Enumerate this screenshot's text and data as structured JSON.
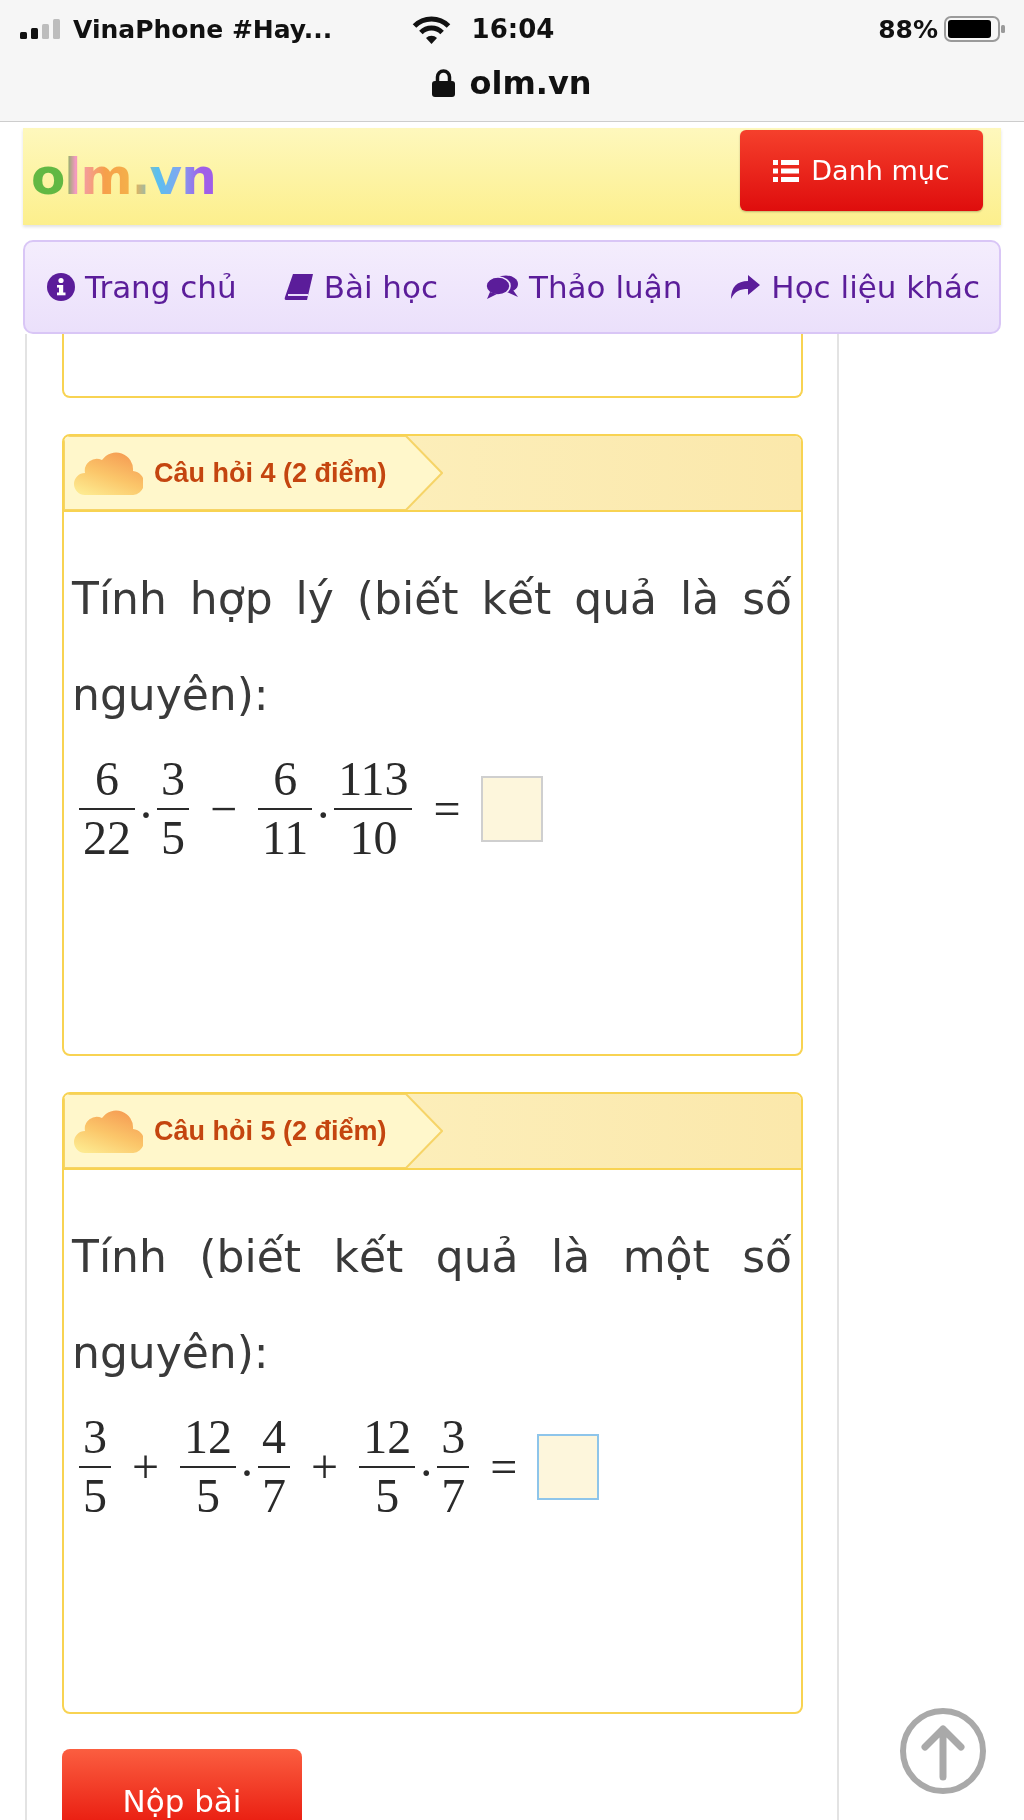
{
  "status_bar": {
    "carrier": "VinaPhone #Hay...",
    "time": "16:04",
    "battery": "88%",
    "url": "olm.vn"
  },
  "header": {
    "logo": "olm.vn",
    "menu_button": "Danh mục"
  },
  "nav": {
    "items": [
      {
        "kind": "info",
        "label": "Trang chủ"
      },
      {
        "kind": "book",
        "label": "Bài học"
      },
      {
        "kind": "comments",
        "label": "Thảo luận"
      },
      {
        "kind": "share",
        "label": "Học liệu khác"
      }
    ]
  },
  "questions": [
    {
      "title": "Câu hỏi 4 (2 điểm)",
      "prompt": "Tính hợp lý (biết kết quả là số nguyên):",
      "expression": [
        {
          "kind": "lead",
          "numerator": "6",
          "denominator": "22"
        },
        {
          "kind": "product",
          "operator": "·",
          "numerator": "3",
          "denominator": "5"
        },
        {
          "kind": "binary",
          "operator": "−",
          "numerator": "6",
          "denominator": "11"
        },
        {
          "kind": "product",
          "operator": "·",
          "numerator": "113",
          "denominator": "10"
        }
      ],
      "equals_sign": "=",
      "answer_box": {
        "focused": false
      }
    },
    {
      "title": "Câu hỏi 5 (2 điểm)",
      "prompt": "Tính (biết kết quả là một số nguyên):",
      "expression": [
        {
          "kind": "lead",
          "numerator": "3",
          "denominator": "5"
        },
        {
          "kind": "binary",
          "operator": "+",
          "numerator": "12",
          "denominator": "5"
        },
        {
          "kind": "product",
          "operator": "·",
          "numerator": "4",
          "denominator": "7"
        },
        {
          "kind": "binary",
          "operator": "+",
          "numerator": "12",
          "denominator": "5"
        },
        {
          "kind": "product",
          "operator": "·",
          "numerator": "3",
          "denominator": "7"
        }
      ],
      "equals_sign": "=",
      "answer_box": {
        "focused": true
      }
    }
  ],
  "submit_button": "Nộp bài"
}
